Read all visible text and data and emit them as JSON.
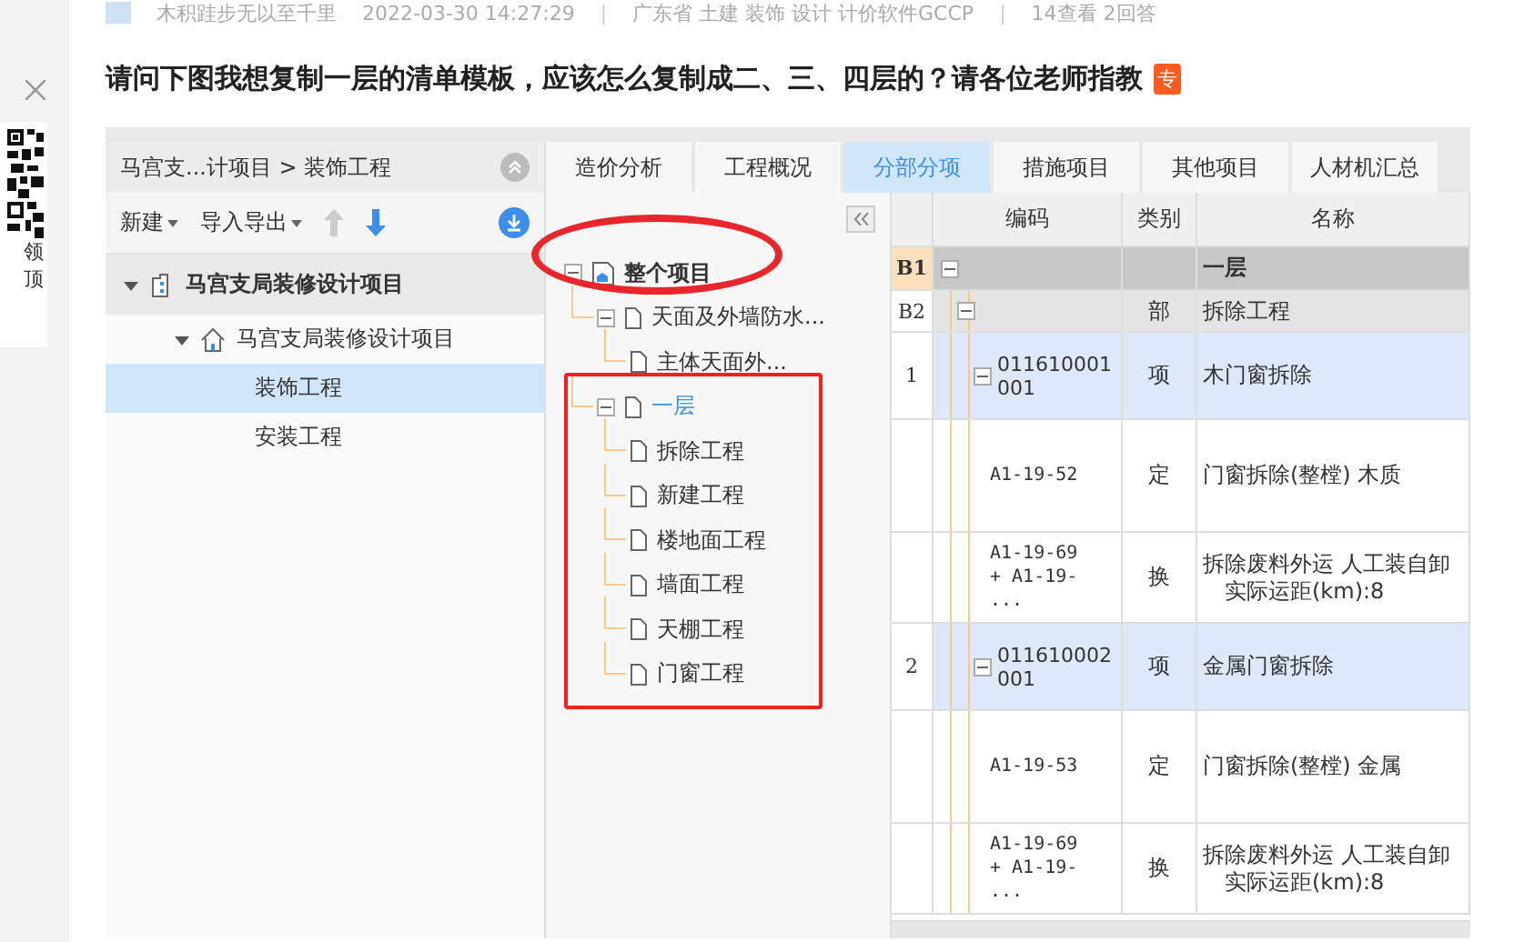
{
  "sidebar": {
    "qr_caption": [
      "领",
      "顶"
    ]
  },
  "post": {
    "meta": {
      "author": "木积跬步无以至千里",
      "date": "2022-03-30 14:27:29",
      "tags": "广东省 土建 装饰 设计 计价软件GCCP",
      "stats": "14查看 2回答",
      "separator": "|"
    },
    "title": "请问下图我想复制一层的清单模板，应该怎么复制成二、三、四层的？请各位老师指教",
    "badge": "专"
  },
  "app": {
    "breadcrumb": "马宫支...计项目 > 装饰工程",
    "toolbar": [
      {
        "kind": "menu",
        "label": "新建"
      },
      {
        "kind": "menu",
        "label": "导入导出"
      },
      {
        "kind": "arrow-up",
        "disabled": true
      },
      {
        "kind": "arrow-down",
        "disabled": false
      }
    ],
    "project_tree": [
      {
        "label": "马宫支局装修设计项目",
        "kind": "project",
        "expanded": true,
        "selected": false,
        "children": [
          {
            "label": "马宫支局装修设计项目",
            "kind": "unit",
            "expanded": true,
            "selected": false,
            "children": [
              {
                "label": "装饰工程",
                "kind": "leaf",
                "selected": true
              },
              {
                "label": "安装工程",
                "kind": "leaf",
                "selected": false
              }
            ]
          }
        ]
      }
    ],
    "tabs": [
      {
        "label": "造价分析",
        "selected": false
      },
      {
        "label": "工程概况",
        "selected": false
      },
      {
        "label": "分部分项",
        "selected": true
      },
      {
        "label": "措施项目",
        "selected": false
      },
      {
        "label": "其他项目",
        "selected": false
      },
      {
        "label": "人材机汇总",
        "selected": false
      }
    ],
    "division_tree": [
      {
        "label": "整个项目",
        "kind": "root",
        "expanded": true,
        "selected": false,
        "children": [
          {
            "label": "天面及外墙防水...",
            "kind": "doc",
            "expanded": true,
            "selected": false,
            "children": [
              {
                "label": "主体天面外...",
                "kind": "doc",
                "selected": false
              }
            ]
          },
          {
            "label": "一层",
            "kind": "doc",
            "expanded": true,
            "selected": true,
            "children": [
              {
                "label": "拆除工程",
                "kind": "doc",
                "selected": false
              },
              {
                "label": "新建工程",
                "kind": "doc",
                "selected": false
              },
              {
                "label": "楼地面工程",
                "kind": "doc",
                "selected": false
              },
              {
                "label": "墙面工程",
                "kind": "doc",
                "selected": false
              },
              {
                "label": "天棚工程",
                "kind": "doc",
                "selected": false
              },
              {
                "label": "门窗工程",
                "kind": "doc",
                "selected": false
              }
            ]
          }
        ]
      }
    ],
    "table": {
      "columns": [
        "编码",
        "类别",
        "名称"
      ],
      "rows": [
        {
          "kind": "division",
          "index": "B1",
          "expanded": true,
          "name": "一层"
        },
        {
          "kind": "subdivision",
          "index": "B2",
          "expanded": true,
          "type": "部",
          "name": "拆除工程"
        },
        {
          "kind": "item",
          "index": "1",
          "expanded": true,
          "code": "011610001001",
          "type": "项",
          "name": "木门窗拆除"
        },
        {
          "kind": "quota",
          "code": "A1-19-52",
          "type": "定",
          "name": "门窗拆除(整樘) 木质"
        },
        {
          "kind": "change",
          "code": "A1-19-69\n+ A1-19-\n...",
          "type": "换",
          "name": "拆除废料外运 人工装自卸",
          "detail": "实际运距(km):8"
        },
        {
          "kind": "item",
          "index": "2",
          "expanded": true,
          "code": "011610002001",
          "type": "项",
          "name": "金属门窗拆除"
        },
        {
          "kind": "quota",
          "code": "A1-19-53",
          "type": "定",
          "name": "门窗拆除(整樘) 金属"
        },
        {
          "kind": "change",
          "code": "A1-19-69\n+ A1-19-\n...",
          "type": "换",
          "name": "拆除废料外运 人工装自卸",
          "detail": "实际运距(km):8"
        }
      ]
    }
  },
  "annotations": [
    {
      "kind": "ellipse",
      "color": "#e8262b"
    },
    {
      "kind": "rectangle",
      "color": "#f0211f"
    }
  ]
}
